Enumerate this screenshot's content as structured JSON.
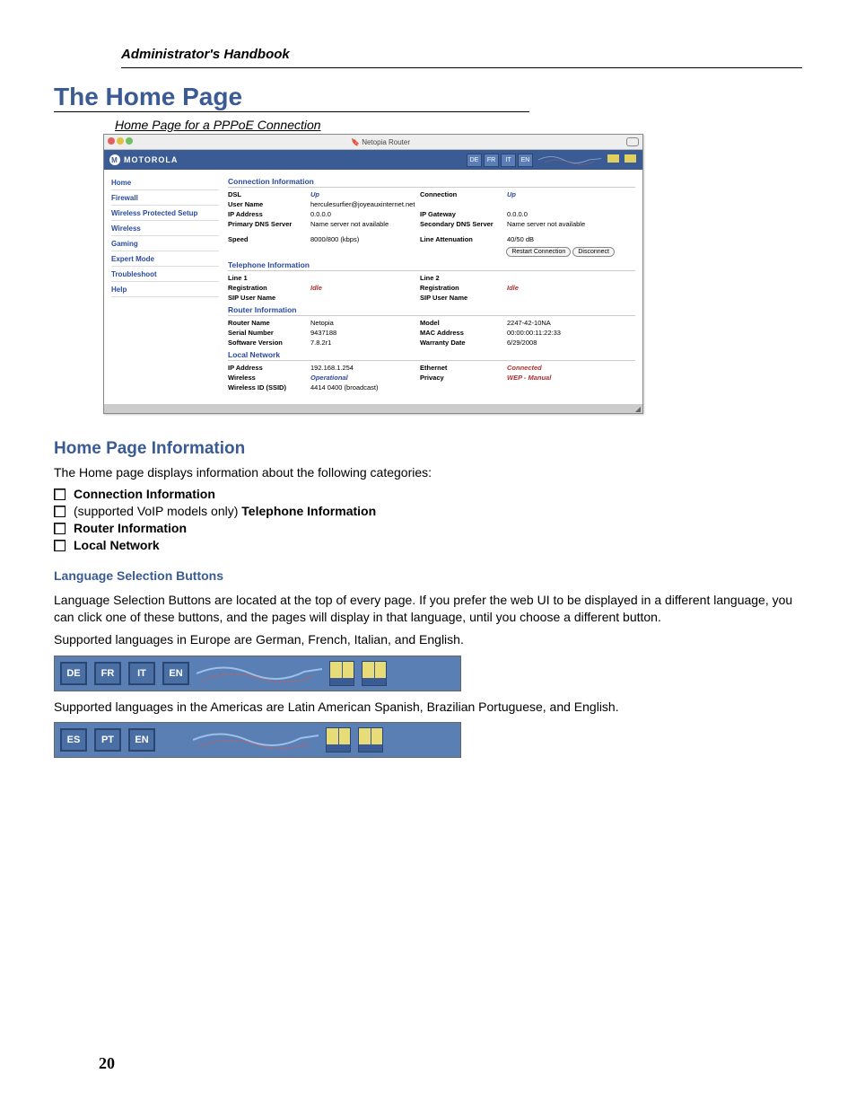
{
  "doc": {
    "header": "Administrator's Handbook",
    "h1": "The Home Page",
    "caption": "Home Page for a PPPoE Connection",
    "page_num": "20"
  },
  "browser": {
    "title": "Netopia Router",
    "brand": "MOTOROLA",
    "langs": [
      "DE",
      "FR",
      "IT",
      "EN"
    ],
    "nav": [
      "Home",
      "Firewall",
      "Wireless Protected Setup",
      "Wireless",
      "Gaming",
      "Expert Mode",
      "Troubleshoot",
      "Help"
    ],
    "sec_conn": "Connection Information",
    "conn": {
      "dsl_l": "DSL",
      "dsl_v": "Up",
      "connection_l": "Connection",
      "connection_v": "Up",
      "user_l": "User Name",
      "user_v": "herculesurfier@joyeauxinternet.net",
      "ip_l": "IP Address",
      "ip_v": "0.0.0.0",
      "gw_l": "IP Gateway",
      "gw_v": "0.0.0.0",
      "pdns_l": "Primary DNS Server",
      "pdns_v": "Name server not available",
      "sdns_l": "Secondary DNS Server",
      "sdns_v": "Name server not available",
      "speed_l": "Speed",
      "speed_v": "8000/800 (kbps)",
      "att_l": "Line Attenuation",
      "att_v": "40/50 dB",
      "btn_restart": "Restart Connection",
      "btn_disc": "Disconnect"
    },
    "sec_tel": "Telephone Information",
    "tel": {
      "l1": "Line 1",
      "l2": "Line 2",
      "reg_l": "Registration",
      "reg_v": "Idle",
      "sip_l": "SIP User Name"
    },
    "sec_router": "Router Information",
    "router": {
      "name_l": "Router Name",
      "name_v": "Netopia",
      "model_l": "Model",
      "model_v": "2247-42-10NA",
      "sn_l": "Serial Number",
      "sn_v": "9437188",
      "mac_l": "MAC Address",
      "mac_v": "00:00:00:11:22:33",
      "sw_l": "Software Version",
      "sw_v": "7.8.2r1",
      "wd_l": "Warranty Date",
      "wd_v": "6/29/2008"
    },
    "sec_local": "Local Network",
    "local": {
      "ip_l": "IP Address",
      "ip_v": "192.168.1.254",
      "eth_l": "Ethernet",
      "eth_v": "Connected",
      "wl_l": "Wireless",
      "wl_v": "Operational",
      "priv_l": "Privacy",
      "priv_v": "WEP - Manual",
      "ssid_l": "Wireless ID (SSID)",
      "ssid_v": "4414 0400 (broadcast)"
    }
  },
  "text": {
    "h2": "Home Page Information",
    "intro": "The Home page displays information about the following categories:",
    "li1": "Connection Information",
    "li2a": "(supported VoIP models only) ",
    "li2b": "Telephone Information",
    "li3": "Router Information",
    "li4": "Local Network",
    "h3": "Language Selection Buttons",
    "p1": "Language Selection Buttons are located at the top of every page. If you prefer the web UI to be displayed in a different language, you can click one of these buttons, and the pages will display in that language, until you choose a different button.",
    "p2": "Supported languages in Europe are German, French, Italian, and English.",
    "p3": "Supported languages in the Americas are Latin American Spanish, Brazilian Portuguese, and English."
  },
  "banner_eu": [
    "DE",
    "FR",
    "IT",
    "EN"
  ],
  "banner_am": [
    "ES",
    "PT",
    "EN"
  ]
}
